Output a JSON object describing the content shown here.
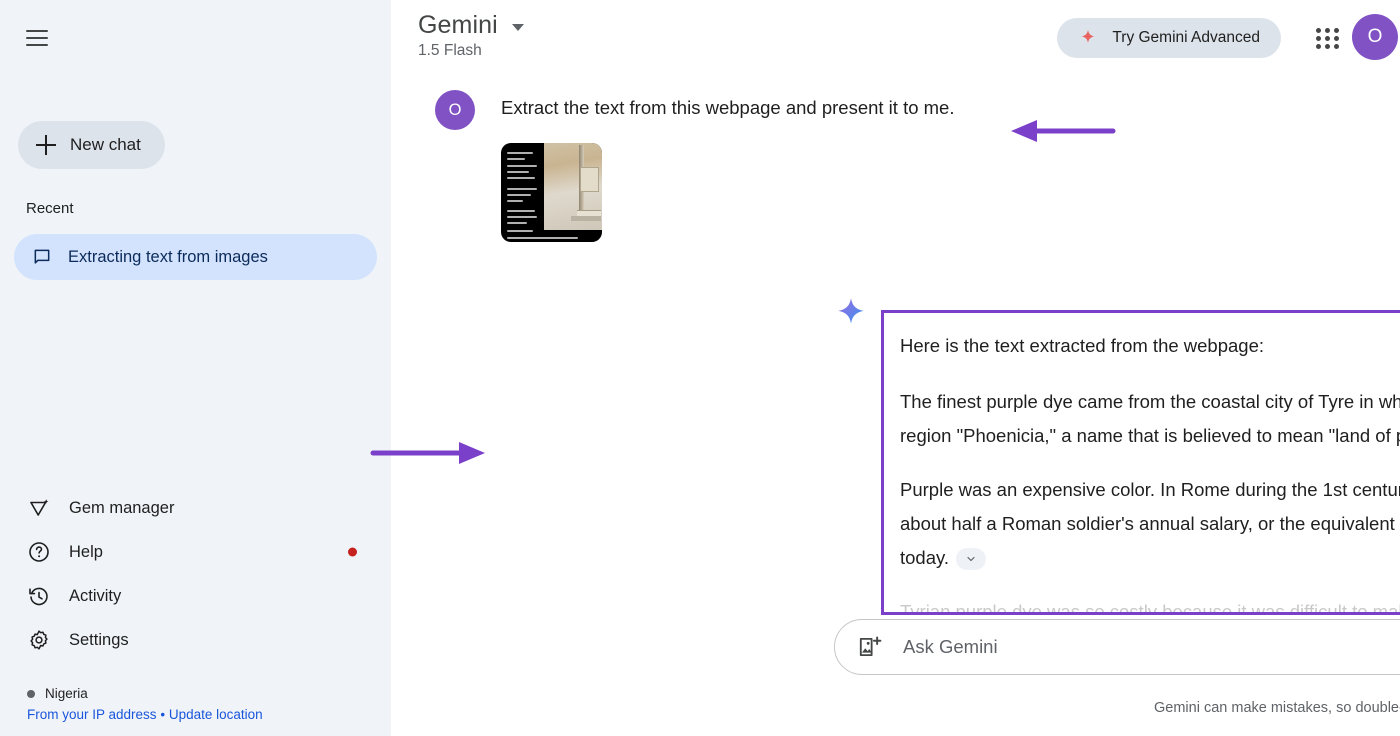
{
  "sidebar": {
    "menu_icon": "hamburger-menu-icon",
    "new_chat": {
      "label": "New chat",
      "icon": "plus-icon"
    },
    "recent_label": "Recent",
    "conversations": [
      {
        "label": "Extracting text from images",
        "icon": "chat-bubble-icon",
        "active": true
      }
    ],
    "nav": [
      {
        "label": "Gem manager",
        "icon": "gem-icon",
        "badge": false
      },
      {
        "label": "Help",
        "icon": "help-circle-icon",
        "badge": true
      },
      {
        "label": "Activity",
        "icon": "history-clock-icon",
        "badge": false
      },
      {
        "label": "Settings",
        "icon": "gear-icon",
        "badge": false
      }
    ],
    "location": {
      "country": "Nigeria",
      "source_text": "From your IP address",
      "separator": "•",
      "update_link": "Update location"
    }
  },
  "header": {
    "title": "Gemini",
    "model": "1.5 Flash",
    "dropdown_icon": "chevron-down-icon",
    "advanced_button": {
      "label": "Try Gemini Advanced",
      "icon": "sparkle-icon"
    },
    "apps_icon": "google-apps-grid-icon",
    "avatar": {
      "initial": "O",
      "color": "#8052c4"
    }
  },
  "conversation": {
    "user": {
      "avatar_initial": "O",
      "message": "Extract the text from this webpage and present it to me.",
      "attachment": {
        "name": "webpage-screenshot-thumbnail",
        "alt": "Screenshot of a dark webpage with a classical fresco image"
      }
    },
    "assistant": {
      "icon": "gemini-sparkle-icon",
      "paragraphs": [
        "Here is the text extracted from the webpage:",
        "The finest purple dye came from the coastal city of Tyre in what is now Lebanon. The Greeks called this region \"Phoenicia,\" a name that is believed to mean \"land of purple.\"",
        "Purple was an expensive color. In Rome during the 1st century CE, a pound of Tyrian purple dye cost about half a Roman soldier's annual salary, or the equivalent of the cost of a diamond engagement ring today."
      ],
      "faded_paragraph": "Tyrian purple dye was so costly because it was difficult to make. The source of the dye was",
      "expand_icon": "chevron-down-icon"
    }
  },
  "composer": {
    "add_image_icon": "add-image-icon",
    "placeholder": "Ask Gemini",
    "value": "",
    "status_dot_color": "#0f8a72",
    "mic_icon": "microphone-icon"
  },
  "disclaimer": "Gemini can make mistakes, so double-check it",
  "annotations": {
    "color": "#7b40c9",
    "arrows": [
      {
        "name": "arrow-pointing-to-user-message",
        "direction": "left"
      },
      {
        "name": "arrow-pointing-to-response-box",
        "direction": "right"
      }
    ],
    "highlight_box": {
      "name": "response-highlight-box",
      "color": "#7b40c9"
    }
  },
  "colors": {
    "sidebar_bg": "#f0f4f9",
    "active_convo_bg": "#d3e3fd",
    "button_bg": "#dde3ea",
    "accent_purple": "#7b40c9",
    "badge_red": "#c5221f",
    "link_blue": "#1a56db"
  }
}
